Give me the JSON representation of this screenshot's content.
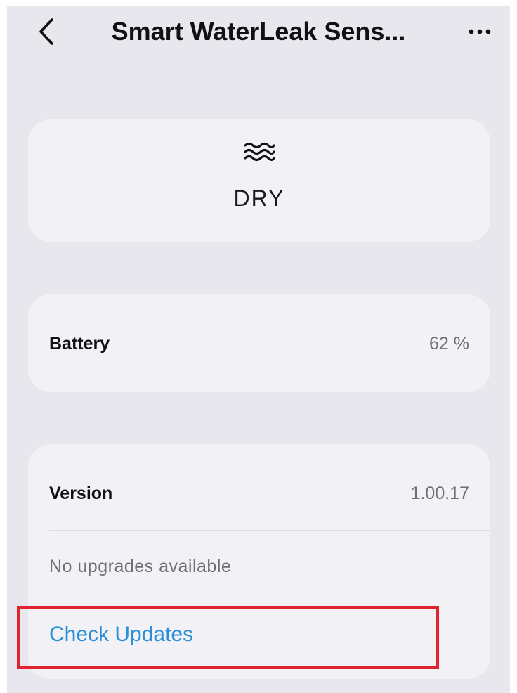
{
  "header": {
    "title": "Smart WaterLeak Sens...",
    "back_icon": "chevron-left-icon",
    "more_icon": "more-horizontal-icon"
  },
  "status": {
    "icon": "water-waves-icon",
    "value": "DRY"
  },
  "battery": {
    "label": "Battery",
    "value": "62 %"
  },
  "version": {
    "label": "Version",
    "value": "1.00.17",
    "note": "No upgrades available",
    "action_label": "Check Updates"
  },
  "colors": {
    "background": "#e8e7ee",
    "card": "#f2f2f6",
    "link": "#2b8fd6",
    "highlight": "#e0242e"
  }
}
